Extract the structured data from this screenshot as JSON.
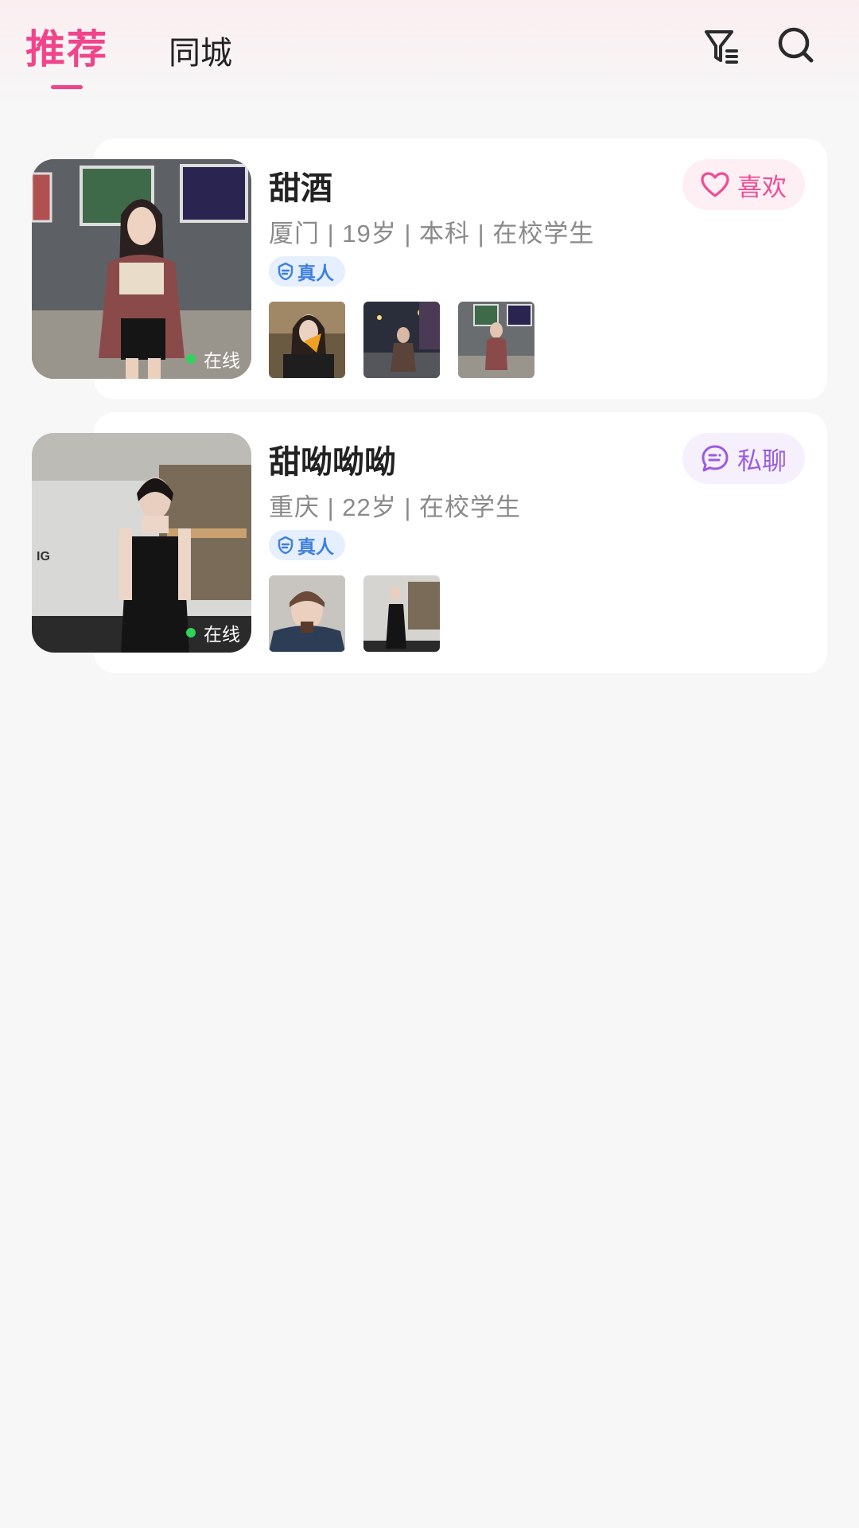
{
  "header": {
    "tab_recommend": "推荐",
    "tab_same_city": "同城",
    "accent_color": "#f0458a",
    "filter_icon": "filter-icon",
    "search_icon": "search-icon"
  },
  "profiles": [
    {
      "name": "甜酒",
      "meta": "厦门 | 19岁 | 本科 | 在校学生",
      "badge": "真人",
      "status": "在线",
      "action_label": "喜欢",
      "action_icon": "heart-icon",
      "photo_count": 3
    },
    {
      "name": "甜呦呦呦",
      "meta": "重庆 | 22岁 | 在校学生",
      "badge": "真人",
      "status": "在线",
      "action_label": "私聊",
      "action_icon": "chat-icon",
      "photo_count": 2
    }
  ]
}
